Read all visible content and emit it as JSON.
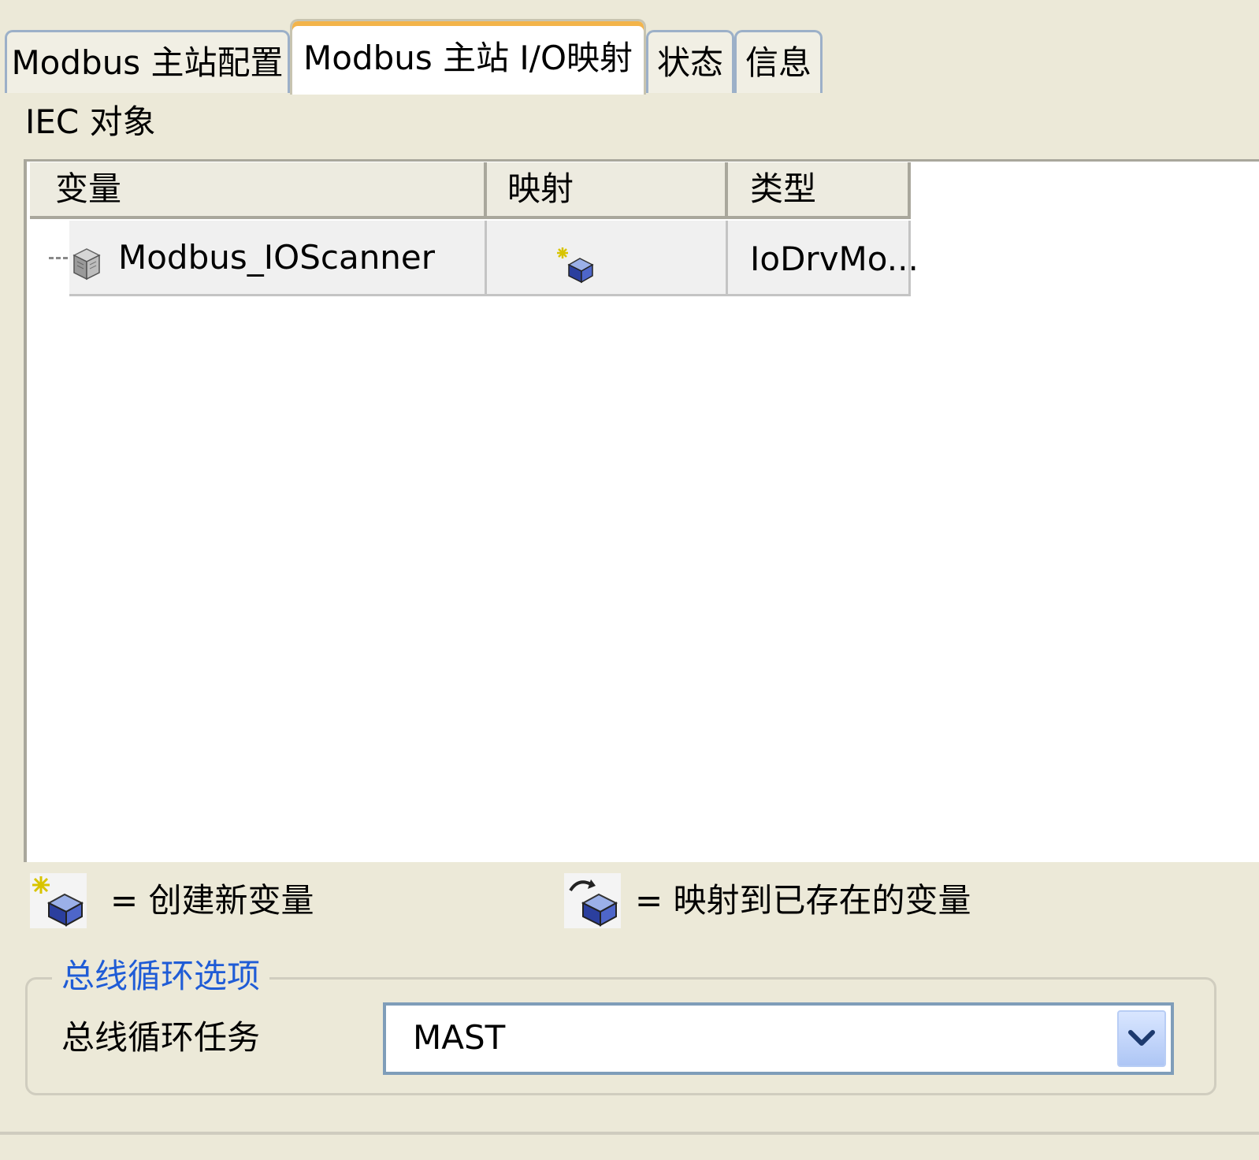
{
  "tabs": [
    {
      "label": "Modbus 主站配置",
      "active": false
    },
    {
      "label": "Modbus 主站 I/O映射",
      "active": true
    },
    {
      "label": "状态",
      "active": false
    },
    {
      "label": "信息",
      "active": false
    }
  ],
  "iec_objects": {
    "title": "IEC 对象",
    "columns": [
      "变量",
      "映射",
      "类型"
    ],
    "rows": [
      {
        "variable": "Modbus_IOScanner",
        "mapping_icon": "create-new-variable-icon",
        "type": "IoDrvMo..."
      }
    ]
  },
  "legend": {
    "create_icon": "create-new-variable-icon",
    "create_text": "= 创建新变量",
    "map_icon": "map-existing-variable-icon",
    "map_text": "= 映射到已存在的变量"
  },
  "bus_cycle": {
    "group_title": "总线循环选项",
    "task_label": "总线循环任务",
    "task_value": "MAST"
  },
  "colors": {
    "active_tab_accent": "#f3b44a",
    "group_title": "#1f5cd6",
    "panel_bg": "#ece9d8"
  }
}
